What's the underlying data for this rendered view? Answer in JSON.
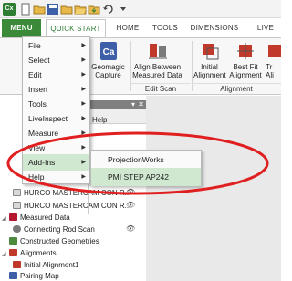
{
  "ribbon": {
    "tabs": [
      "MENU",
      "QUICK START",
      "HOME",
      "TOOLS",
      "DIMENSIONS",
      "LIVE"
    ],
    "buttons": {
      "geomagic": "Geomagic\nCapture",
      "align_between": "Align Between\nMeasured Data",
      "initial_alignment": "Initial\nAlignment",
      "best_fit": "Best Fit\nAlignment",
      "trailing": "Tr\nAli"
    },
    "groups": {
      "edit_scan": "Edit Scan",
      "alignment": "Alignment"
    },
    "accent_color": "#3a8a3a"
  },
  "menu": {
    "items": [
      {
        "label": "File"
      },
      {
        "label": "Select"
      },
      {
        "label": "Edit"
      },
      {
        "label": "Insert"
      },
      {
        "label": "Tools"
      },
      {
        "label": "LiveInspect"
      },
      {
        "label": "Measure"
      },
      {
        "label": "View"
      },
      {
        "label": "Add-Ins"
      },
      {
        "label": "Help"
      }
    ],
    "submenu": [
      "ProjectionWorks",
      "PMI STEP AP242"
    ]
  },
  "panel": {
    "help_label": "Help"
  },
  "tree": [
    {
      "label": "HURCO MASTERCAM CON R..."
    },
    {
      "label": "HURCO MASTERCAM CON R..."
    },
    {
      "label": "Measured Data"
    },
    {
      "label": "Connecting Rod Scan"
    },
    {
      "label": "Constructed Geometries"
    },
    {
      "label": "Alignments"
    },
    {
      "label": "Initial Alignment1"
    },
    {
      "label": "Pairing Map"
    }
  ]
}
